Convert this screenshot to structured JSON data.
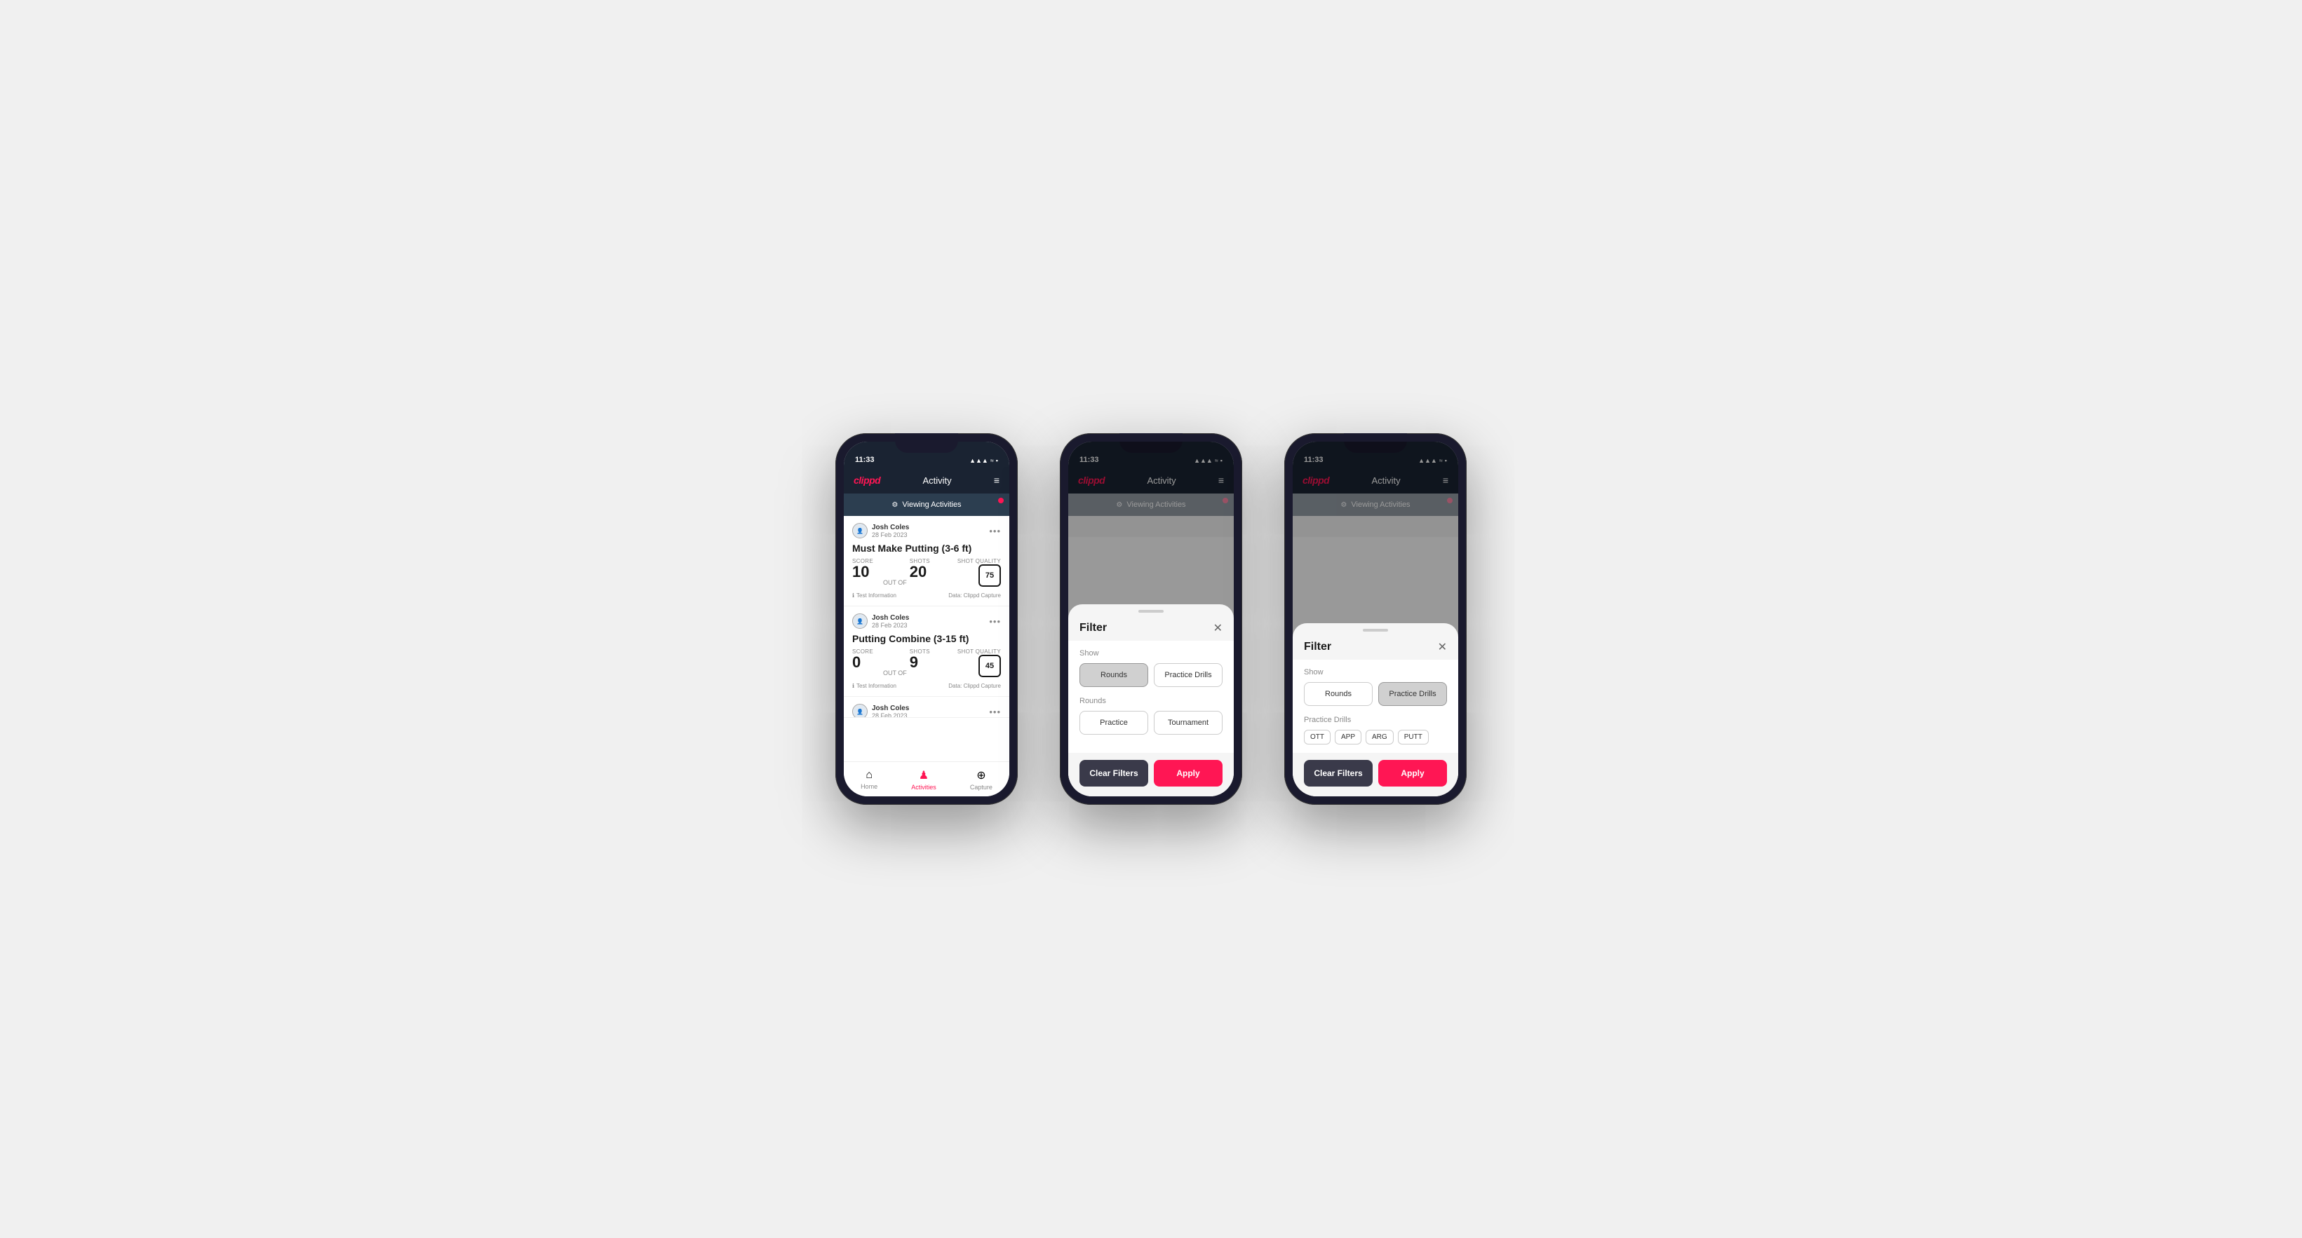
{
  "phone1": {
    "status": {
      "time": "11:33",
      "icons": "▲ ≈ ⬛"
    },
    "nav": {
      "logo": "clippd",
      "title": "Activity",
      "menu_icon": "≡"
    },
    "viewing_bar": {
      "icon": "⚙",
      "text": "Viewing Activities"
    },
    "cards": [
      {
        "user": "Josh Coles",
        "date": "28 Feb 2023",
        "title": "Must Make Putting (3-6 ft)",
        "score_label": "Score",
        "score": "10",
        "out_of_label": "OUT OF",
        "shots_label": "Shots",
        "shots": "20",
        "shot_quality_label": "Shot Quality",
        "shot_quality": "75",
        "test_info": "Test Information",
        "data_source": "Data: Clippd Capture"
      },
      {
        "user": "Josh Coles",
        "date": "28 Feb 2023",
        "title": "Putting Combine (3-15 ft)",
        "score_label": "Score",
        "score": "0",
        "out_of_label": "OUT OF",
        "shots_label": "Shots",
        "shots": "9",
        "shot_quality_label": "Shot Quality",
        "shot_quality": "45",
        "test_info": "Test Information",
        "data_source": "Data: Clippd Capture"
      },
      {
        "user": "Josh Coles",
        "date": "28 Feb 2023",
        "title": "",
        "score_label": "",
        "score": "",
        "out_of_label": "",
        "shots_label": "",
        "shots": "",
        "shot_quality_label": "",
        "shot_quality": "",
        "test_info": "",
        "data_source": ""
      }
    ],
    "tabs": [
      {
        "label": "Home",
        "icon": "⌂",
        "active": false
      },
      {
        "label": "Activities",
        "icon": "♟",
        "active": true
      },
      {
        "label": "Capture",
        "icon": "+",
        "active": false
      }
    ]
  },
  "phone2": {
    "status": {
      "time": "11:33"
    },
    "nav": {
      "logo": "clippd",
      "title": "Activity",
      "menu_icon": "≡"
    },
    "viewing_bar": {
      "text": "Viewing Activities"
    },
    "filter": {
      "title": "Filter",
      "show_label": "Show",
      "rounds_btn": "Rounds",
      "practice_drills_btn": "Practice Drills",
      "rounds_section_label": "Rounds",
      "practice_btn": "Practice",
      "tournament_btn": "Tournament",
      "clear_btn": "Clear Filters",
      "apply_btn": "Apply",
      "active_tab": "rounds"
    }
  },
  "phone3": {
    "status": {
      "time": "11:33"
    },
    "nav": {
      "logo": "clippd",
      "title": "Activity",
      "menu_icon": "≡"
    },
    "viewing_bar": {
      "text": "Viewing Activities"
    },
    "filter": {
      "title": "Filter",
      "show_label": "Show",
      "rounds_btn": "Rounds",
      "practice_drills_btn": "Practice Drills",
      "practice_drills_section_label": "Practice Drills",
      "drill_tags": [
        "OTT",
        "APP",
        "ARG",
        "PUTT"
      ],
      "clear_btn": "Clear Filters",
      "apply_btn": "Apply",
      "active_tab": "practice_drills"
    }
  }
}
